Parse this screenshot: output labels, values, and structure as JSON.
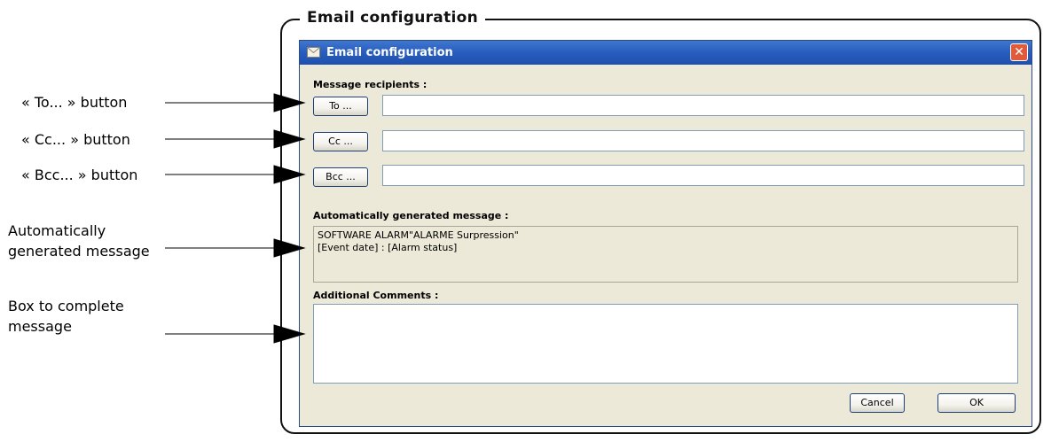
{
  "frame_title": "Email configuration",
  "annotations": {
    "to_button": "« To... » button",
    "cc_button": "« Cc... » button",
    "bcc_button": "« Bcc... » button",
    "auto_message_line1": "Automatically",
    "auto_message_line2": "generated message",
    "complete_box_line1": "Box to complete",
    "complete_box_line2": "message"
  },
  "window": {
    "title": "Email configuration",
    "title_icon": "envelope-icon",
    "close_icon": "close-icon"
  },
  "recipients": {
    "label": "Message recipients :",
    "to_label": "To ...",
    "to_value": "",
    "cc_label": "Cc ...",
    "cc_value": "",
    "bcc_label": "Bcc ...",
    "bcc_value": ""
  },
  "auto_message": {
    "label": "Automatically generated message :",
    "line1": "SOFTWARE ALARM\"ALARME Surpression\"",
    "line2": "[Event date] : [Alarm status]"
  },
  "comments": {
    "label": "Additional Comments :",
    "value": ""
  },
  "footer": {
    "cancel_label": "Cancel",
    "ok_label": "OK"
  },
  "colors": {
    "titlebar": "#2a5fbf",
    "window_bg": "#ece9d8",
    "close_button": "#e05b3a"
  }
}
